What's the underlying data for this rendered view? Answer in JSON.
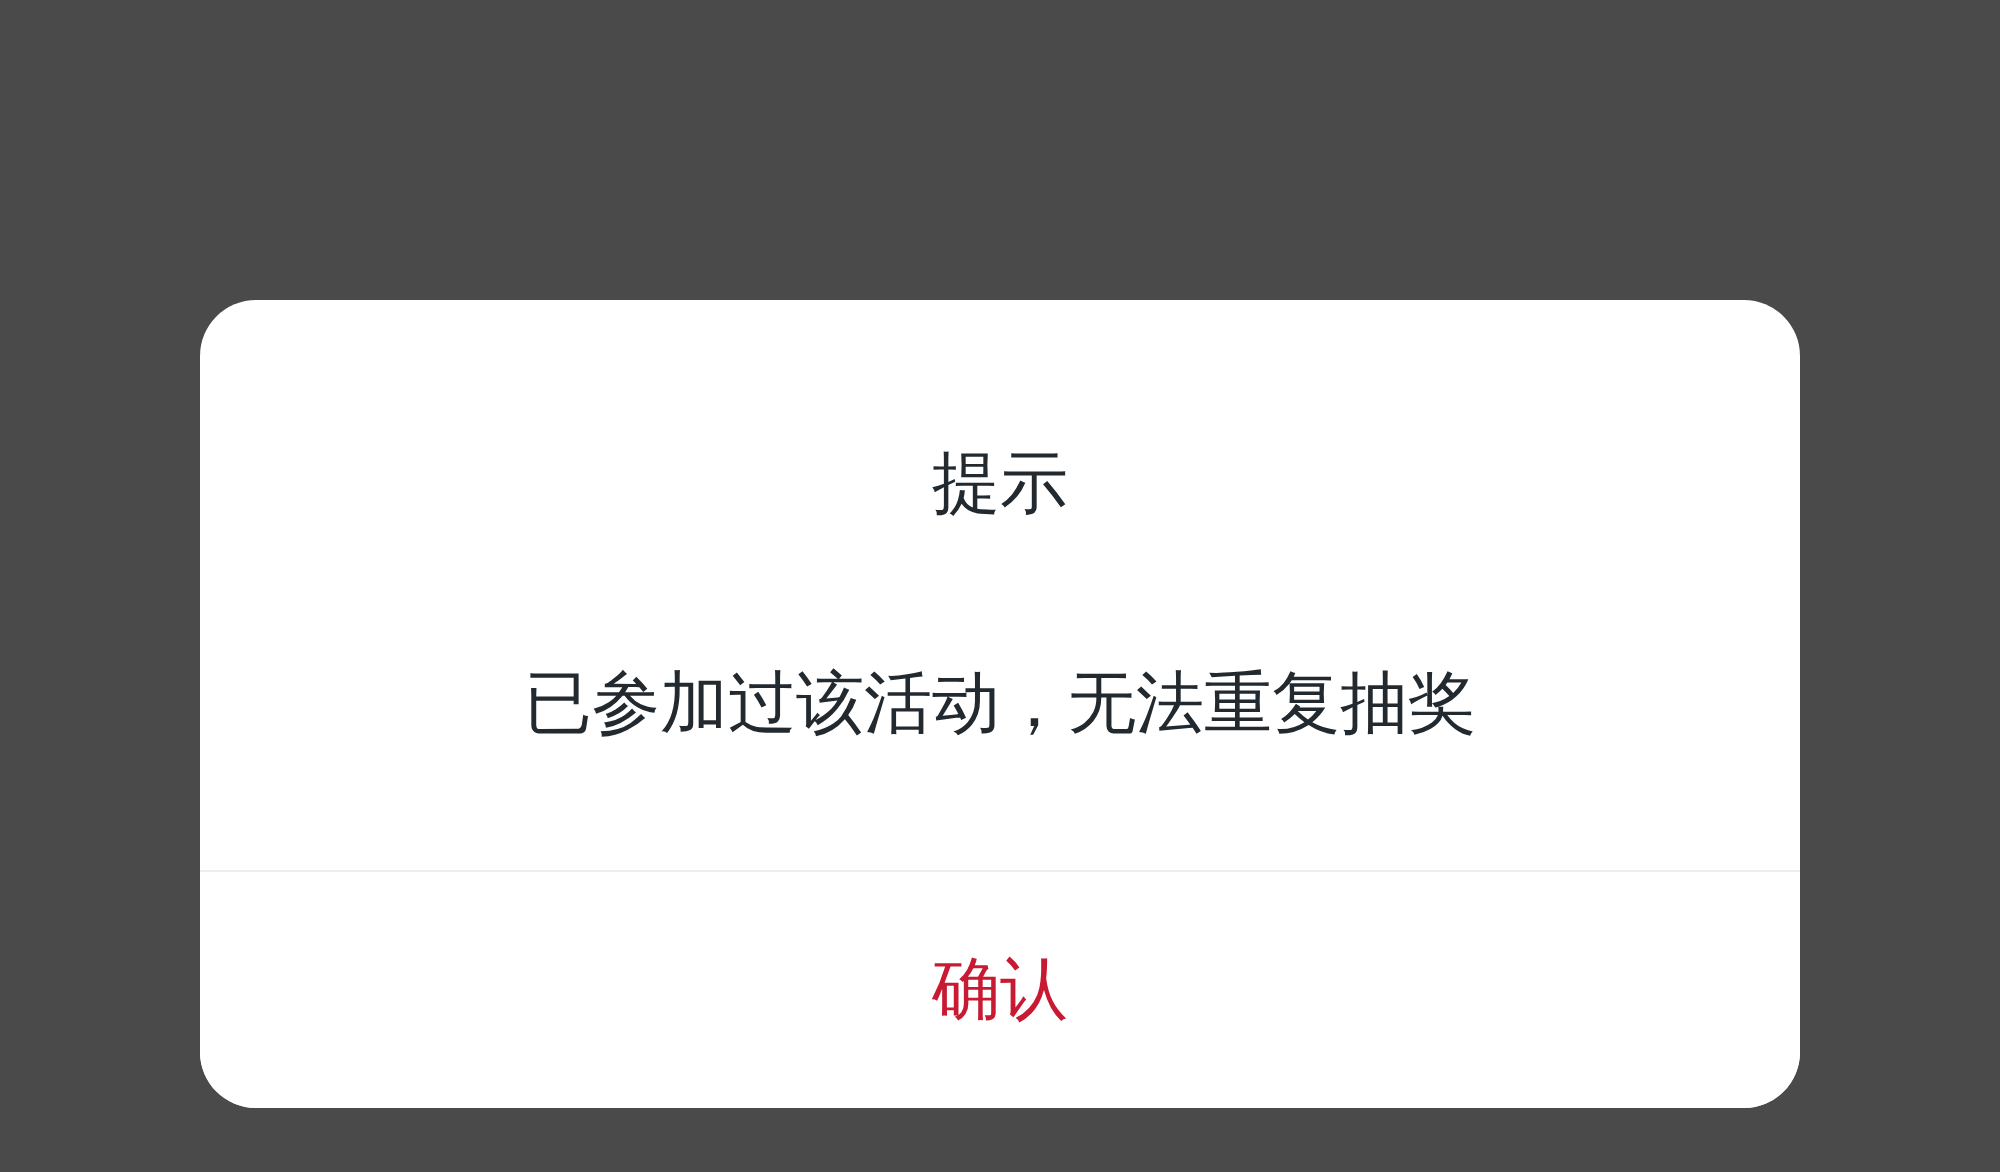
{
  "dialog": {
    "title": "提示",
    "message": "已参加过该活动，无法重复抽奖",
    "buttons": [
      "确认"
    ]
  }
}
